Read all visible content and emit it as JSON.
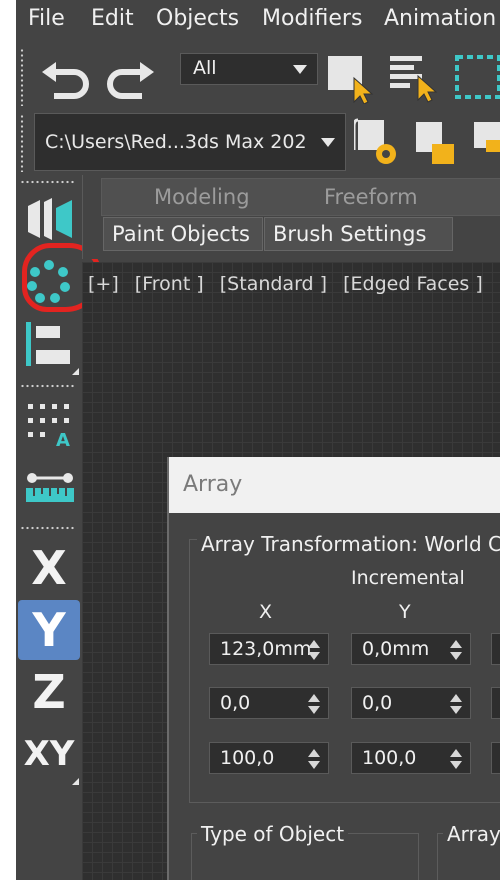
{
  "menu": [
    "File",
    "Edit",
    "Objects",
    "Modifiers",
    "Animation"
  ],
  "toolbar": {
    "icons": [
      "undo-icon",
      "redo-icon",
      "select-object-icon",
      "select-by-name-icon",
      "rectangle-selection-icon"
    ],
    "filter_value": "All",
    "project_path": "C:\\Users\\Red...3ds Max 202",
    "project_icons": [
      "project-settings-icon",
      "project-folder-icon",
      "project-open-icon"
    ]
  },
  "command_panel": {
    "icons": [
      "create-icon",
      "hierarchy-icon",
      "layers-icon",
      "align-icon",
      "measure-icon"
    ],
    "axes": [
      "X",
      "Y",
      "Z",
      "XY"
    ],
    "active_axis": "Y",
    "accent": "#5b86c4"
  },
  "ribbon": {
    "tabs": [
      "Modeling",
      "Freeform"
    ],
    "buttons": [
      "Paint Objects",
      "Brush Settings"
    ]
  },
  "viewport": {
    "labels": [
      "[+]",
      "[Front ]",
      "[Standard ]",
      "[Edged Faces ]"
    ]
  },
  "annotation": {
    "color": "#e32420"
  },
  "array_dialog": {
    "title": "Array",
    "group_title": "Array Transformation: World Co",
    "incremental_label": "Incremental",
    "col_x": "X",
    "col_y": "Y",
    "rows": [
      [
        "123,0mm",
        "0,0mm"
      ],
      [
        "0,0",
        "0,0"
      ],
      [
        "100,0",
        "100,0"
      ]
    ],
    "type_of_object_label": "Type of Object",
    "array_label": "Array"
  }
}
